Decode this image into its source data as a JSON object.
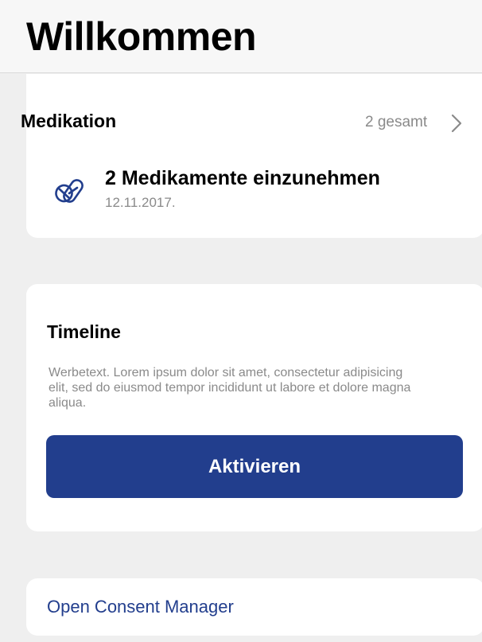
{
  "header": {
    "title": "Willkommen"
  },
  "medication": {
    "title": "Medikation",
    "count": "2 gesamt",
    "chevron_icon": "chevron-right-icon",
    "item": {
      "icon": "pill-icon",
      "title": "2 Medikamente einzunehmen",
      "date": "12.11.2017."
    }
  },
  "timeline": {
    "title": "Timeline",
    "text": "Werbetext. Lorem ipsum dolor sit amet, consectetur adipisicing elit, sed do eiusmod tempor incididunt ut labore et dolore magna aliqua.",
    "button_label": "Aktivieren"
  },
  "consent": {
    "link_label": "Open Consent Manager"
  },
  "colors": {
    "accent": "#223e8d",
    "background": "#efefef",
    "card": "#ffffff",
    "secondary_text": "#8a8a8a"
  }
}
